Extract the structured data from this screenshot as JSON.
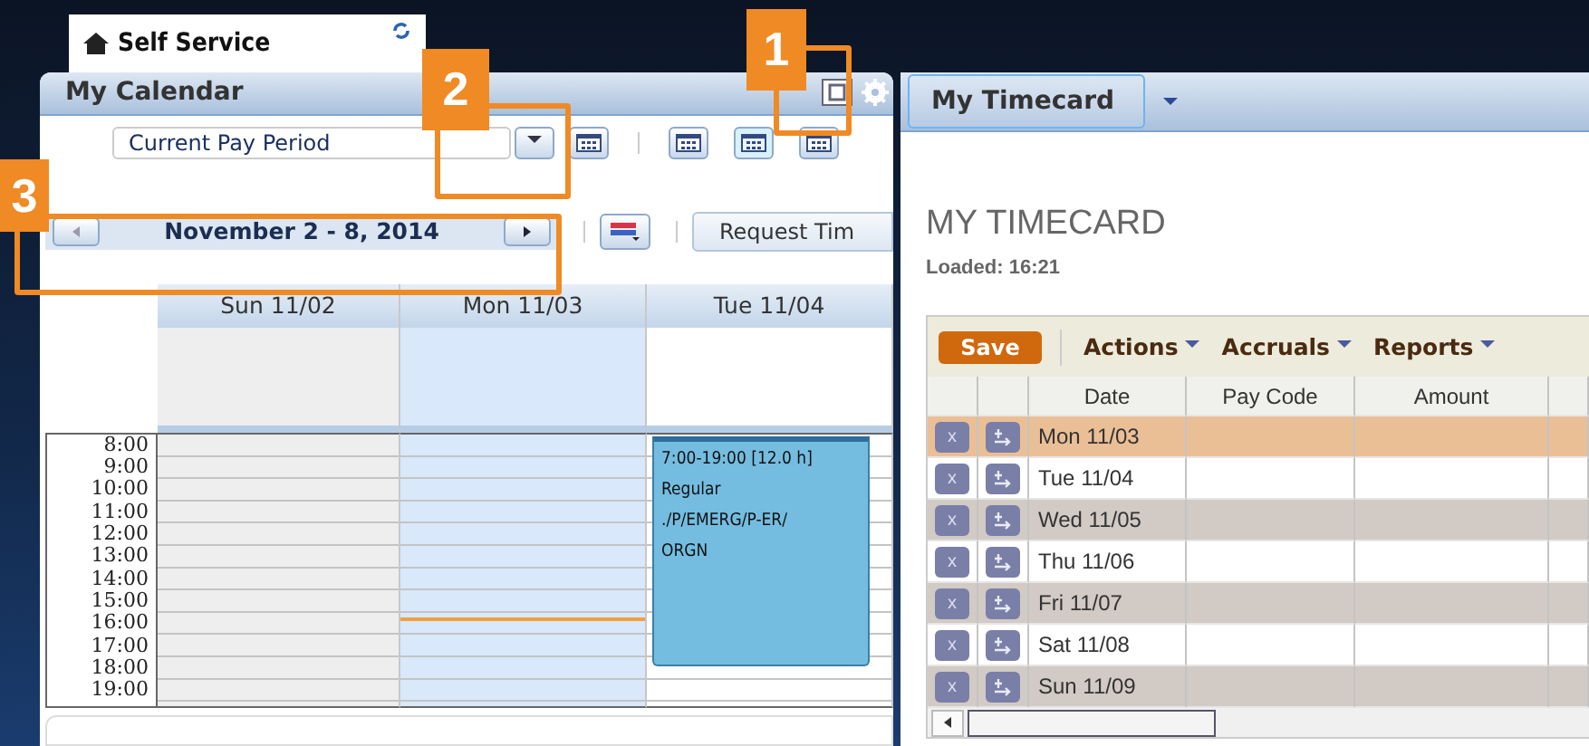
{
  "workspace_tab": {
    "title": "Self Service"
  },
  "calendar": {
    "title": "My Calendar",
    "period": "Current Pay Period",
    "range": "November 2 - 8, 2014",
    "request_button": "Request Tim",
    "views": [
      {
        "selected": false
      },
      {
        "selected": true
      },
      {
        "selected": false
      }
    ],
    "days": [
      {
        "label": "Sun 11/02",
        "kind": "weekend",
        "selected": false
      },
      {
        "label": "Mon 11/03",
        "kind": "weekday",
        "selected": true
      },
      {
        "label": "Tue 11/04",
        "kind": "weekday",
        "selected": false,
        "event": {
          "lines": [
            "7:00-19:00 [12.0 h]",
            "Regular",
            "./P/EMERG/P-ER/",
            "ORGN"
          ]
        }
      }
    ],
    "hours": [
      "8:00",
      "9:00",
      "10:00",
      "11:00",
      "12:00",
      "13:00",
      "14:00",
      "15:00",
      "16:00",
      "17:00",
      "18:00",
      "19:00"
    ]
  },
  "timecard": {
    "tab": "My Timecard",
    "title": "MY TIMECARD",
    "loaded": "Loaded: 16:21",
    "save": "Save",
    "menus": [
      "Actions",
      "Accruals",
      "Reports"
    ],
    "columns": [
      "Date",
      "Pay Code",
      "Amount"
    ],
    "rows": [
      {
        "delete": "x",
        "date": "Mon 11/03",
        "selected": true
      },
      {
        "delete": "x",
        "date": "Tue 11/04",
        "selected": false
      },
      {
        "delete": "x",
        "date": "Wed 11/05",
        "selected": false
      },
      {
        "delete": "x",
        "date": "Thu 11/06",
        "selected": false
      },
      {
        "delete": "x",
        "date": "Fri 11/07",
        "selected": false
      },
      {
        "delete": "x",
        "date": "Sat 11/08",
        "selected": false
      },
      {
        "delete": "x",
        "date": "Sun 11/09",
        "selected": false
      }
    ]
  },
  "callouts": [
    {
      "label": "1"
    },
    {
      "label": "2"
    },
    {
      "label": "3"
    }
  ]
}
